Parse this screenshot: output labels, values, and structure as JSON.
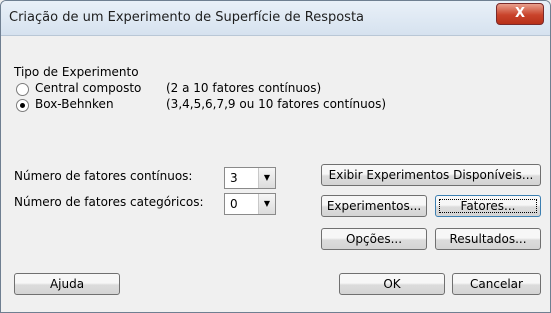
{
  "window": {
    "title": "Criação de um Experimento de Superfície de Resposta",
    "close_label": "X"
  },
  "design_type": {
    "heading": "Tipo de Experimento",
    "options": [
      {
        "label": "Central composto",
        "note": "(2 a 10 fatores contínuos)",
        "selected": false
      },
      {
        "label": "Box-Behnken",
        "note": "(3,4,5,6,7,9 ou 10 fatores contínuos)",
        "selected": true
      }
    ]
  },
  "fields": {
    "continuous_label": "Número de fatores contínuos:",
    "continuous_value": "3",
    "categorical_label": "Número de fatores categóricos:",
    "categorical_value": "0"
  },
  "buttons": {
    "show_available": "Exibir Experimentos Disponíveis...",
    "designs": "Experimentos...",
    "factors": "Fatores...",
    "options": "Opções...",
    "results": "Resultados...",
    "help": "Ajuda",
    "ok": "OK",
    "cancel": "Cancelar"
  }
}
